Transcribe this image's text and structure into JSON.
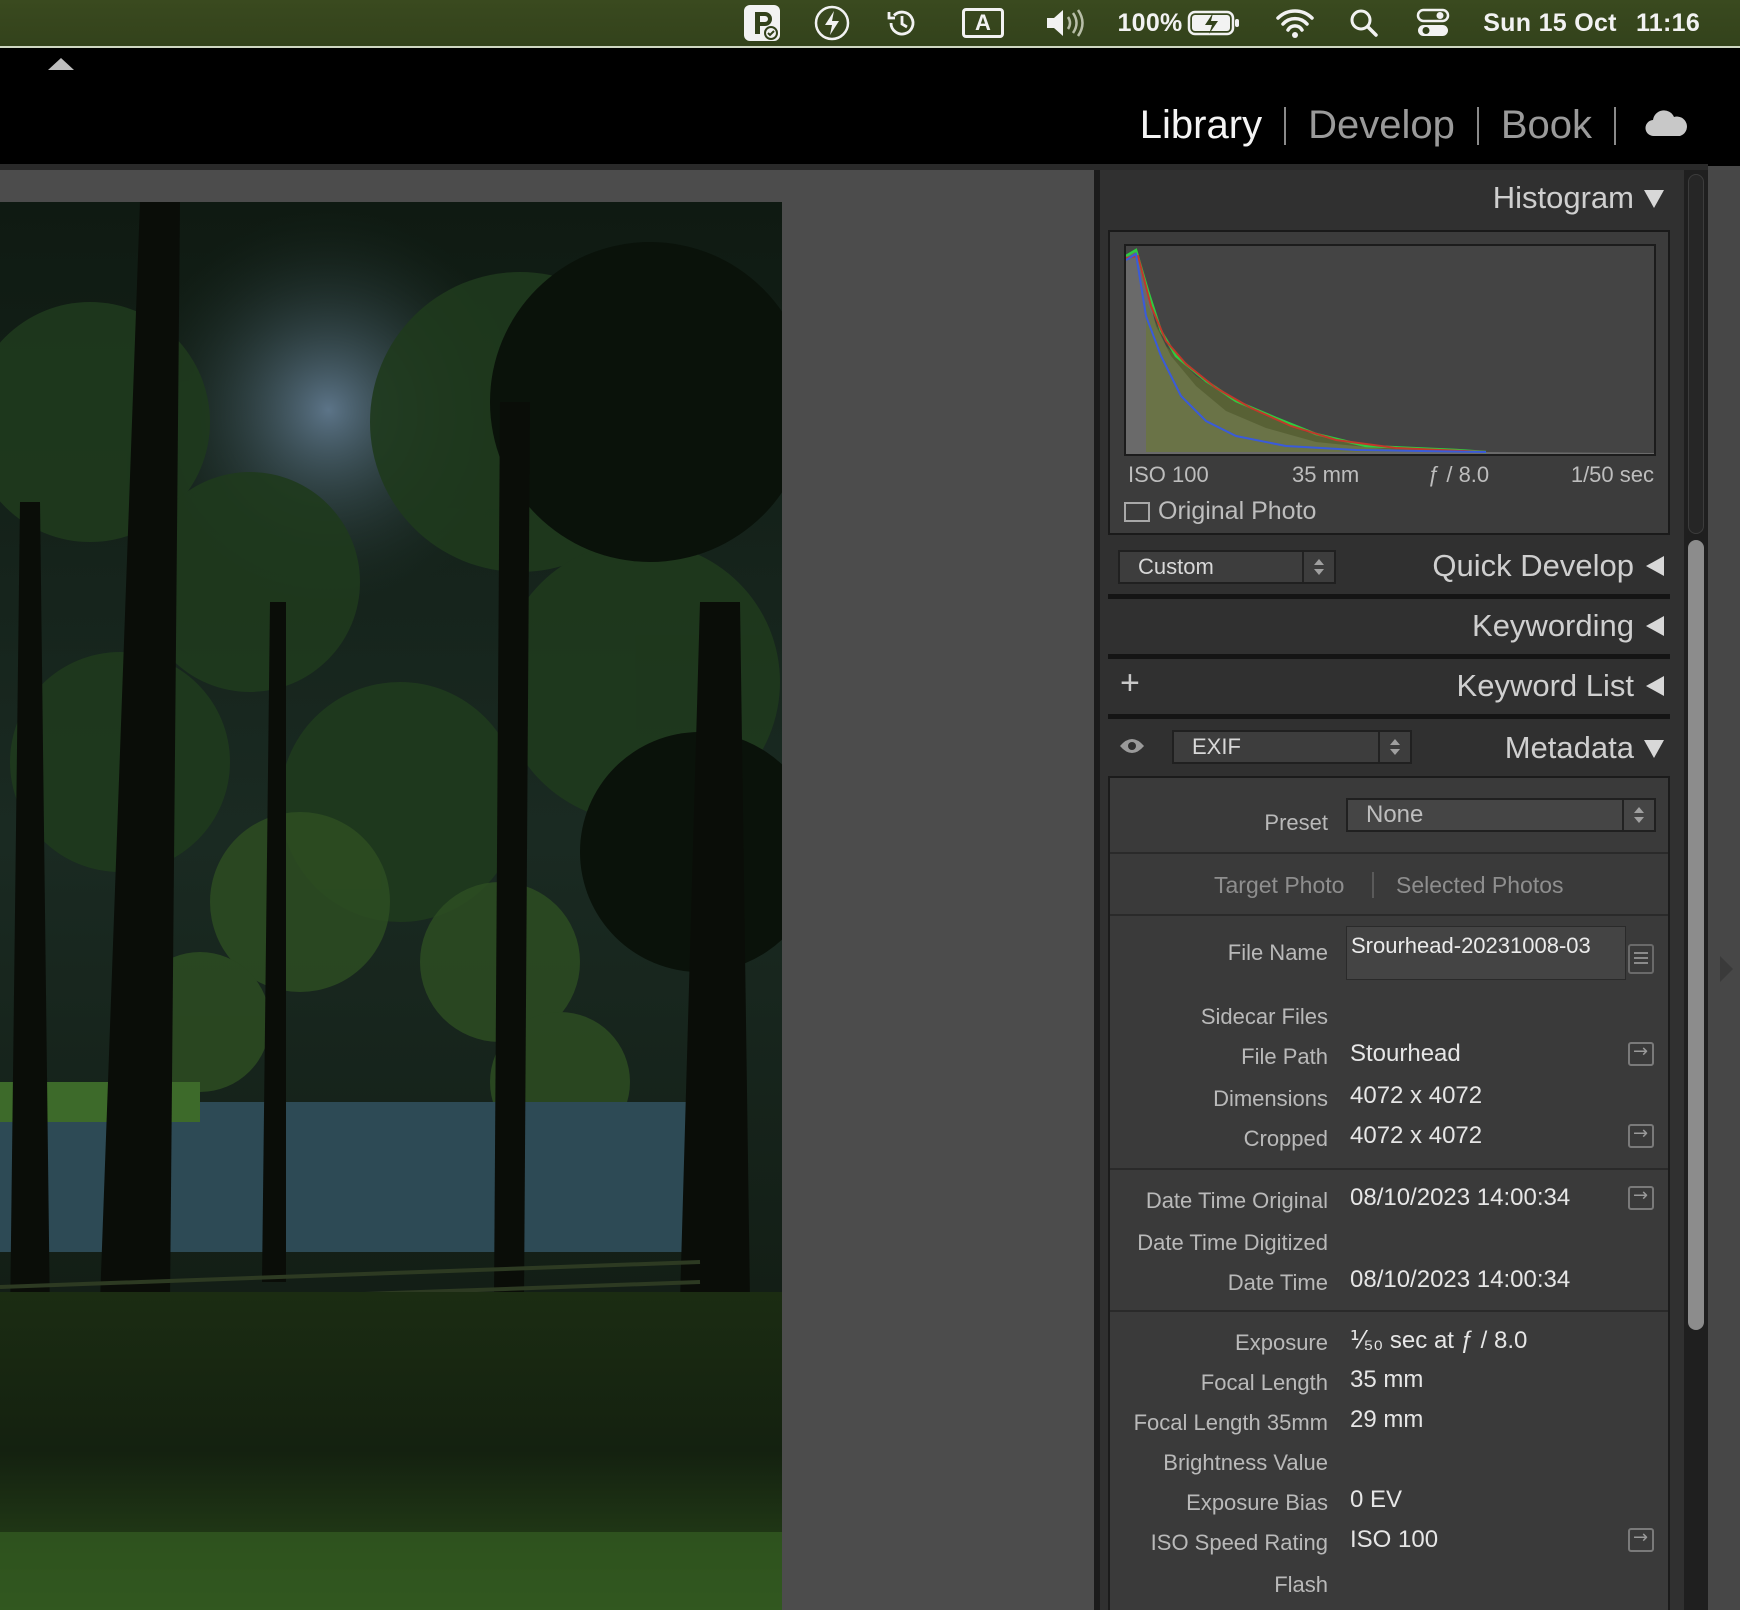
{
  "menubar": {
    "icons": [
      "pixelmator-icon",
      "flash-icon",
      "time-machine-icon",
      "input-source-icon",
      "volume-icon",
      "battery-icon",
      "wifi-icon",
      "search-icon",
      "control-center-icon"
    ],
    "input_source": "A",
    "battery_percent": "100%",
    "date": "Sun 15 Oct",
    "time": "11:16"
  },
  "modules": {
    "items": [
      "Library",
      "Develop",
      "Book"
    ],
    "active": "Library"
  },
  "histogram": {
    "title": "Histogram",
    "iso": "ISO 100",
    "focal": "35 mm",
    "aperture": "ƒ / 8.0",
    "shutter": "1/50 sec",
    "original_photo_label": "Original Photo",
    "colors": {
      "red": "#c0392b",
      "green": "#2ecc40",
      "blue": "#3a5bd9"
    }
  },
  "quick_develop": {
    "title": "Quick Develop",
    "preset": "Custom"
  },
  "keywording": {
    "title": "Keywording"
  },
  "keyword_list": {
    "title": "Keyword List",
    "add": "+"
  },
  "metadata": {
    "title": "Metadata",
    "view": "EXIF",
    "preset_label": "Preset",
    "preset_value": "None",
    "tabs": [
      "Target Photo",
      "Selected Photos"
    ],
    "fields": {
      "file_name": {
        "label": "File Name",
        "value": "Srourhead-20231008-03"
      },
      "sidecar": {
        "label": "Sidecar Files",
        "value": ""
      },
      "file_path": {
        "label": "File Path",
        "value": "Stourhead"
      },
      "dimensions": {
        "label": "Dimensions",
        "value": "4072 x 4072"
      },
      "cropped": {
        "label": "Cropped",
        "value": "4072 x 4072"
      },
      "dt_original": {
        "label": "Date Time Original",
        "value": "08/10/2023 14:00:34"
      },
      "dt_digitized": {
        "label": "Date Time Digitized",
        "value": ""
      },
      "dt": {
        "label": "Date Time",
        "value": "08/10/2023 14:00:34"
      },
      "exposure": {
        "label": "Exposure",
        "value": "⅟₅₀ sec at ƒ / 8.0"
      },
      "focal_length": {
        "label": "Focal Length",
        "value": "35 mm"
      },
      "focal_35": {
        "label": "Focal Length 35mm",
        "value": "29 mm"
      },
      "brightness": {
        "label": "Brightness Value",
        "value": ""
      },
      "exp_bias": {
        "label": "Exposure Bias",
        "value": "0 EV"
      },
      "iso": {
        "label": "ISO Speed Rating",
        "value": "ISO 100"
      },
      "flash": {
        "label": "Flash",
        "value": ""
      }
    }
  }
}
